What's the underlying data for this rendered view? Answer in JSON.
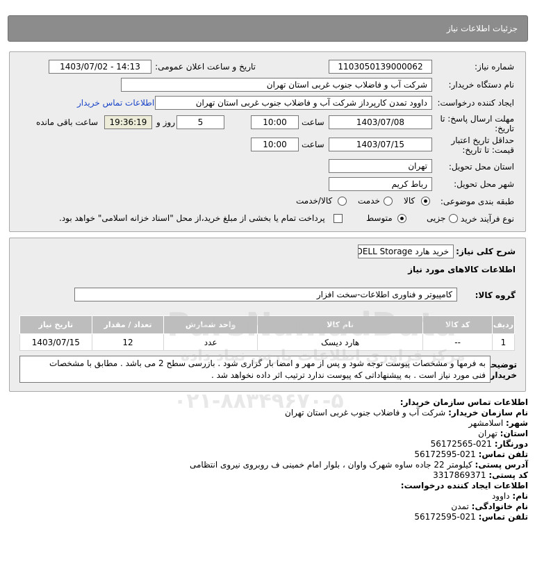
{
  "header": {
    "title": "جزئیات اطلاعات نیاز"
  },
  "need": {
    "number_label": "شماره نیاز:",
    "number": "1103050139000062",
    "announce_label": "تاریخ و ساعت اعلان عمومی:",
    "announce": "1403/07/02 - 14:13",
    "buyer_label": "نام دستگاه خریدار:",
    "buyer": "شرکت آب و فاضلاب جنوب غربی استان تهران",
    "creator_label": "ایجاد کننده درخواست:",
    "creator": "داوود  تمدن  کارپرداز شرکت آب و فاضلاب جنوب غربی استان تهران",
    "contact_link": "اطلاعات تماس خریدار",
    "deadline_label_1": "مهلت ارسال پاسخ: تا",
    "deadline_label_2": "تاریخ:",
    "deadline_date": "1403/07/08",
    "time_label": "ساعت",
    "deadline_time": "10:00",
    "days_value": "5",
    "days_label": "روز و",
    "remaining_time": "19:36:19",
    "remaining_label": "ساعت باقی مانده",
    "validity_label_1": "حداقل تاریخ اعتبار",
    "validity_label_2": "قیمت: تا تاریخ:",
    "validity_date": "1403/07/15",
    "validity_time_label": "ساعت",
    "validity_time": "10:00",
    "province_label": "استان محل تحویل:",
    "province": "تهران",
    "city_label": "شهر محل تحویل:",
    "city": "رباط کریم",
    "category_label": "طبقه بندی موضوعی:",
    "category_options": [
      "کالا",
      "خدمت",
      "کالا/خدمت"
    ],
    "process_label": "نوع فرآیند خرید :",
    "process_options": [
      "جزیی",
      "متوسط"
    ],
    "payment_note": "پرداخت تمام یا بخشی از مبلغ خرید،از محل \"اسناد خزانه اسلامی\" خواهد بود."
  },
  "summary": {
    "label": "شرح کلی نیاز:",
    "value": "خرید هارد DELL Storage",
    "goods_info_title": "اطلاعات کالاهای مورد نیاز",
    "group_label": "گروه کالا:",
    "group_value": "کامپیوتر و فناوری اطلاعات-سخت افزار"
  },
  "table": {
    "headers": [
      "ردیف",
      "کد کالا",
      "نام کالا",
      "واحد شمارش",
      "تعداد / مقدار",
      "تاریخ نیاز"
    ],
    "rows": [
      {
        "row": "1",
        "code": "--",
        "name": "هارد دیسک",
        "unit": "عدد",
        "qty": "12",
        "date": "1403/07/15"
      }
    ]
  },
  "buyer_notes": {
    "label_1": "توضیحات",
    "label_2": "خریدار:",
    "line_1": "به فرمها و مشخصات پیوست توجه شود و پس از مهر و امضا بار گزاری شود . بازرسی سطح 2 می باشد . مطابق با مشخصات",
    "line_2": "فنی مورد نیاز است . به پیشنهاداتی که پیوست ندارد ترتیب اثر داده نخواهد شد ."
  },
  "contact": {
    "title": "اطلاعات تماس سازمان خریدار:",
    "buyer_name_label": "نام سازمان خریدار:",
    "buyer_name": "شرکت آب و فاضلاب جنوب غربی استان تهران",
    "city_label": "شهر:",
    "city": "اسلامشهر",
    "province_label": "استان:",
    "province": "تهران",
    "fax_label": "دورنگار:",
    "fax": "021-56172565",
    "phone_label": "تلفن تماس:",
    "phone": "021-56172595",
    "address_label": "آدرس پستی:",
    "address": "کیلومتر 22 جاده ساوه شهرک واوان ، بلوار امام خمینی ف روبروی نیروی انتظامی",
    "postal_label": "کد پستی:",
    "postal": "3317869371",
    "creator_title": "اطلاعات ایجاد کننده درخواست:",
    "first_name_label": "نام:",
    "first_name": "داوود",
    "last_name_label": "نام خانوادگی:",
    "last_name": "تمدن",
    "creator_phone_label": "تلفن تماس:",
    "creator_phone": "021-56172595"
  },
  "watermark": {
    "brand": "ParsNamadData",
    "line_1": "مرکز فراوری اطلاعات پارس نماد داده",
    "phone": "۰۲۱-۸۸۳۴۹۶۷۰-۵"
  }
}
